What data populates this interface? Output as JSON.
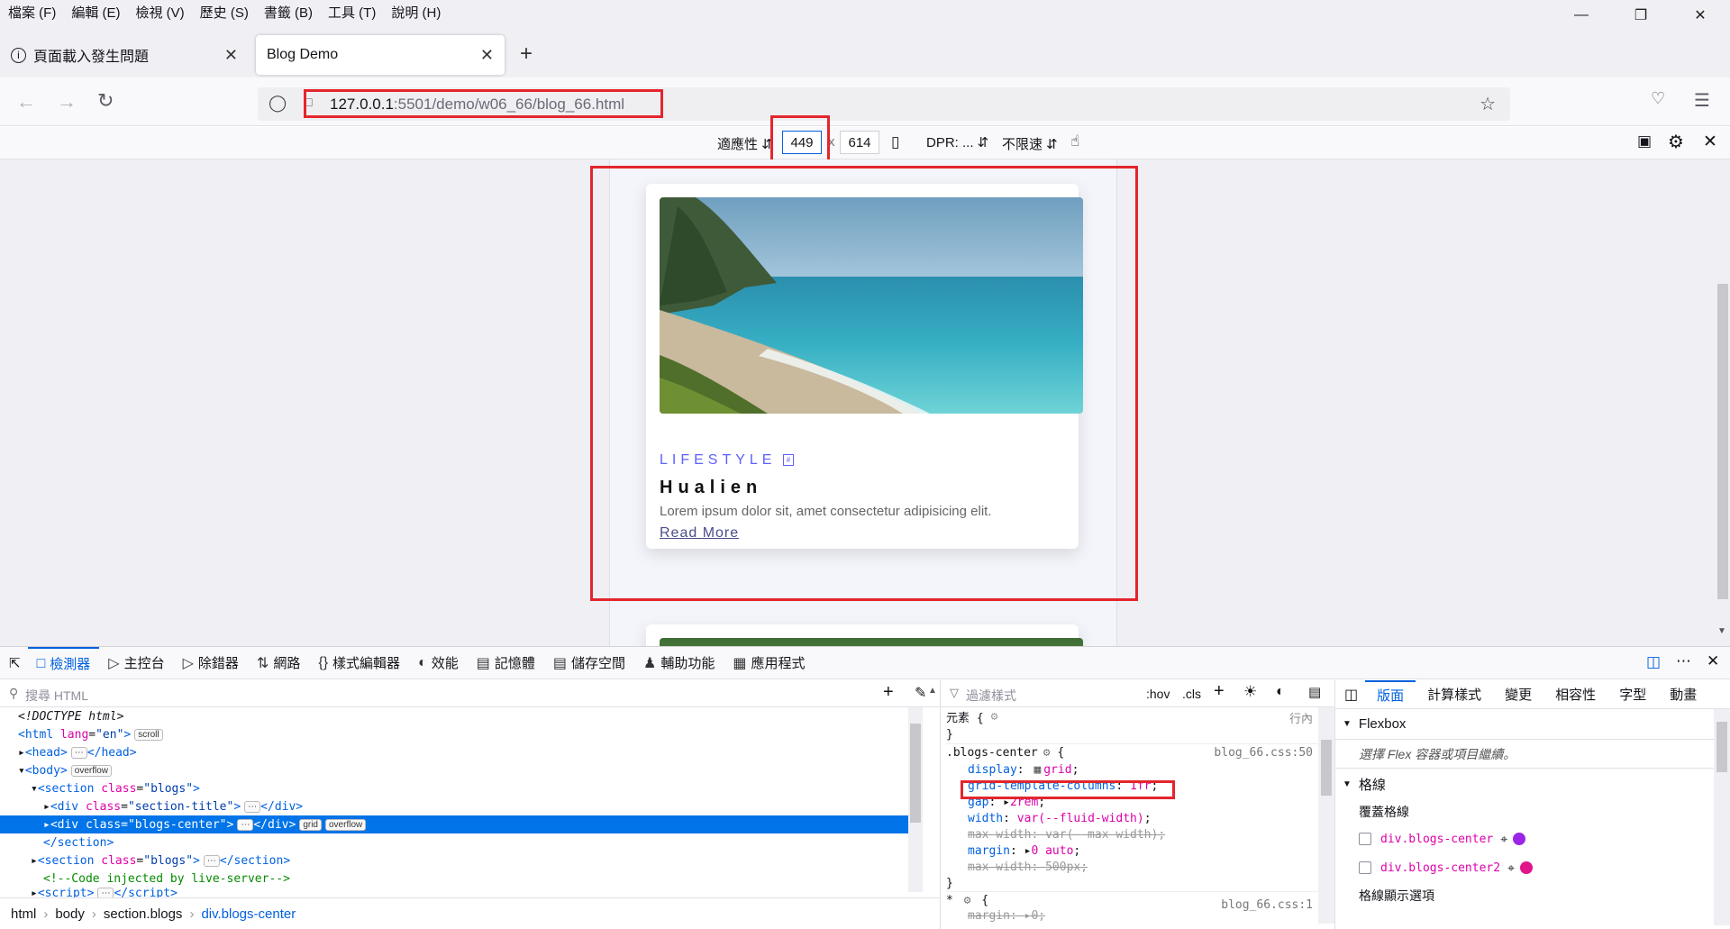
{
  "menu": [
    "檔案 (F)",
    "編輯 (E)",
    "檢視 (V)",
    "歷史 (S)",
    "書籤 (B)",
    "工具 (T)",
    "說明 (H)"
  ],
  "tabs": [
    {
      "label": "頁面載入發生問題",
      "active": false
    },
    {
      "label": "Blog Demo",
      "active": true
    }
  ],
  "url": {
    "host": "127.0.0.1",
    "rest": ":5501/demo/w06_66/blog_66.html"
  },
  "rdm": {
    "device": "適應性",
    "width": "449",
    "height": "614",
    "dpr": "DPR: ...",
    "throttle": "不限速"
  },
  "card": {
    "category": "LIFESTYLE",
    "title": "Hualien",
    "description": "Lorem ipsum dolor sit, amet consectetur adipisicing elit.",
    "link": "Read More"
  },
  "devtools": {
    "tabs": [
      "檢測器",
      "主控台",
      "除錯器",
      "網路",
      "樣式編輯器",
      "效能",
      "記憶體",
      "儲存空間",
      "輔助功能",
      "應用程式"
    ],
    "search_placeholder": "搜尋 HTML",
    "filter_placeholder": "過濾樣式",
    "hov": ":hov",
    "cls": ".cls",
    "breadcrumb": [
      "html",
      "body",
      "section.blogs",
      "div.blogs-center"
    ],
    "rules_header": "元素 {",
    "inline_label": "行內",
    "rule_selector": ".blogs-center",
    "rule_source": "blog_66.css:50",
    "star_source": "blog_66.css:1",
    "layout_tabs": [
      "版面",
      "計算樣式",
      "變更",
      "相容性",
      "字型",
      "動畫"
    ],
    "flexbox_title": "Flexbox",
    "flexbox_hint": "選擇 Flex 容器或項目繼續。",
    "grid_title": "格線",
    "overlay_title": "覆蓋格線",
    "grid_items": [
      {
        "label": "div.blogs-center",
        "color": "#9b25e6"
      },
      {
        "label": "div.blogs-center2",
        "color": "#e0168a"
      }
    ],
    "display_options": "格線顯示選項"
  },
  "colors": {
    "accent": "#0060df",
    "highlight": "#e3262c",
    "card_category": "#5f61ff"
  }
}
